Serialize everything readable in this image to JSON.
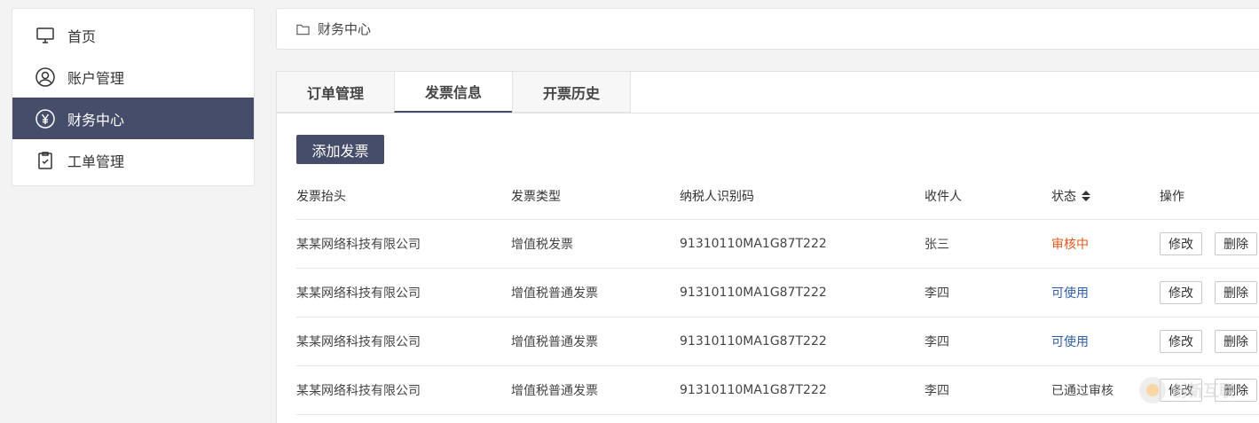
{
  "sidebar": {
    "items": [
      {
        "label": "首页",
        "icon": "monitor-icon"
      },
      {
        "label": "账户管理",
        "icon": "user-circle-icon"
      },
      {
        "label": "财务中心",
        "icon": "yen-circle-icon",
        "active": true
      },
      {
        "label": "工单管理",
        "icon": "clipboard-icon"
      }
    ]
  },
  "breadcrumb": {
    "label": "财务中心",
    "icon": "folder-icon"
  },
  "tabs": [
    {
      "label": "订单管理"
    },
    {
      "label": "发票信息",
      "active": true
    },
    {
      "label": "开票历史"
    }
  ],
  "add_button": "添加发票",
  "table": {
    "headers": [
      "发票抬头",
      "发票类型",
      "纳税人识别码",
      "收件人",
      "状态",
      "操作"
    ],
    "rows": [
      {
        "title": "某某网络科技有限公司",
        "type": "增值税发票",
        "tax_id": "91310110MA1G87T222",
        "recipient": "张三",
        "status": "审核中",
        "status_color": "#e4581d",
        "edit": "修改",
        "delete": "删除"
      },
      {
        "title": "某某网络科技有限公司",
        "type": "增值税普通发票",
        "tax_id": "91310110MA1G87T222",
        "recipient": "李四",
        "status": "可使用",
        "status_color": "#2f5ea8",
        "edit": "修改",
        "delete": "删除"
      },
      {
        "title": "某某网络科技有限公司",
        "type": "增值税普通发票",
        "tax_id": "91310110MA1G87T222",
        "recipient": "李四",
        "status": "可使用",
        "status_color": "#2f5ea8",
        "edit": "修改",
        "delete": "删除"
      },
      {
        "title": "某某网络科技有限公司",
        "type": "增值税普通发票",
        "tax_id": "91310110MA1G87T222",
        "recipient": "李四",
        "status": "已通过审核",
        "status_color": "#444444",
        "edit": "修改",
        "delete": "删除"
      }
    ]
  },
  "colors": {
    "accent": "#454d6b",
    "status_reviewing": "#e4581d",
    "status_available": "#2f5ea8"
  },
  "watermark": "创新互联"
}
